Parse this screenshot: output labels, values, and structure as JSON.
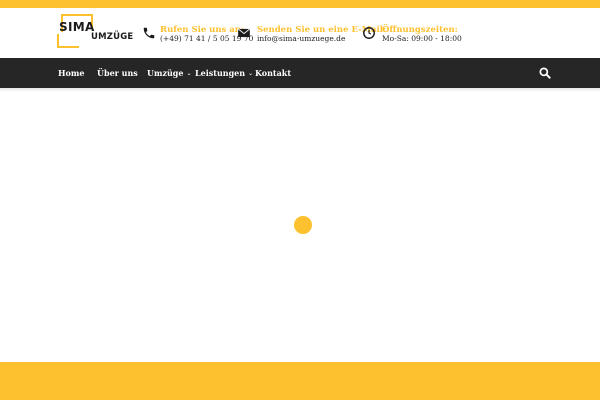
{
  "brand": {
    "line1": "SIMA",
    "line2": "UMZÜGE",
    "accent": "#fdc02f",
    "dark": "#262626"
  },
  "contacts": [
    {
      "icon": "phone-icon",
      "label": "Rufen Sie uns an:",
      "value": "(+49) 71 41 / 5 05 19 70"
    },
    {
      "icon": "envelope-icon",
      "label": "Senden Sie un eine E-Mail:",
      "value": "info@sima-umzuege.de"
    },
    {
      "icon": "clock-icon",
      "label": "Öffnungszeiten:",
      "value": "Mo-Sa: 09:00 - 18:00"
    }
  ],
  "nav": {
    "items": [
      {
        "label": "Home",
        "dropdown": false
      },
      {
        "label": "Über uns",
        "dropdown": false
      },
      {
        "label": "Umzüge",
        "dropdown": true
      },
      {
        "label": "Leistungen",
        "dropdown": true
      },
      {
        "label": "Kontakt",
        "dropdown": false
      }
    ],
    "search_icon": "search-icon"
  },
  "loader_icon": "loading-dot-icon"
}
